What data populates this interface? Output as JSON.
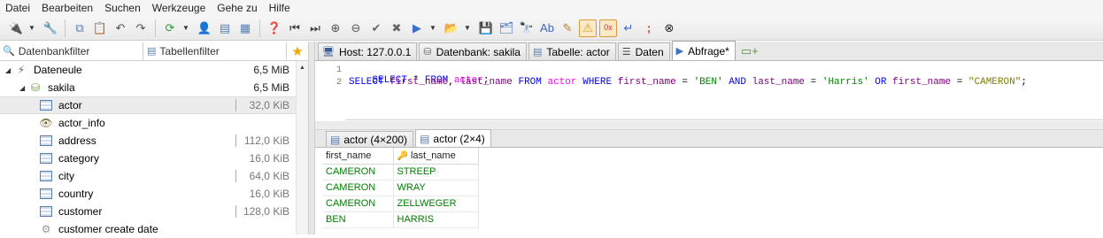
{
  "menu": [
    "Datei",
    "Bearbeiten",
    "Suchen",
    "Werkzeuge",
    "Gehe zu",
    "Hilfe"
  ],
  "toolbar": {
    "icons": [
      "session-manager-icon",
      "wrench-icon",
      "copy-icon",
      "paste-icon",
      "undo-icon",
      "redo-icon",
      "refresh-icon",
      "add-user-icon",
      "import-icon",
      "export-icon",
      "help-icon",
      "first-icon",
      "prev-icon",
      "add-row-icon",
      "delete-row-icon",
      "apply-icon",
      "cancel-icon",
      "run-icon",
      "explain-icon",
      "save-icon",
      "save-all-icon",
      "binoculars-icon",
      "format-icon",
      "edit-icon",
      "warning-icon",
      "zero-x-icon",
      "wrap-icon",
      "semicolon-icon",
      "stop-icon"
    ]
  },
  "filters": {
    "db_filter": "Datenbankfilter",
    "table_filter": "Tabellenfilter"
  },
  "tree": {
    "items": [
      {
        "label": "Dateneule",
        "size": "6,5 MiB",
        "level": 0
      },
      {
        "label": "sakila",
        "size": "6,5 MiB",
        "level": 1
      },
      {
        "label": "actor",
        "size": "32,0 KiB",
        "level": 2
      },
      {
        "label": "actor_info",
        "size": "",
        "level": 2
      },
      {
        "label": "address",
        "size": "112,0 KiB",
        "level": 2
      },
      {
        "label": "category",
        "size": "16,0 KiB",
        "level": 2
      },
      {
        "label": "city",
        "size": "64,0 KiB",
        "level": 2
      },
      {
        "label": "country",
        "size": "16,0 KiB",
        "level": 2
      },
      {
        "label": "customer",
        "size": "128,0 KiB",
        "level": 2
      },
      {
        "label": "customer create date",
        "size": "",
        "level": 2
      }
    ]
  },
  "tabs": [
    {
      "label": "Host: 127.0.0.1",
      "icon": "host-icon"
    },
    {
      "label": "Datenbank: sakila",
      "icon": "database-icon"
    },
    {
      "label": "Tabelle: actor",
      "icon": "table-icon"
    },
    {
      "label": "Daten",
      "icon": "data-icon"
    },
    {
      "label": "Abfrage*",
      "icon": "query-icon"
    }
  ],
  "editor": {
    "line_numbers": [
      "1",
      "2"
    ],
    "line1": "SELECT * FROM actor;",
    "line2": "SELECT first_name, last_name FROM actor WHERE first_name = 'BEN' AND last_name = 'Harris' OR first_name = \"CAMERON\";"
  },
  "result_tabs": [
    {
      "label": "actor (4×200)"
    },
    {
      "label": "actor (2×4)"
    }
  ],
  "grid": {
    "columns": [
      "first_name",
      "last_name"
    ],
    "rows": [
      [
        "CAMERON",
        "STREEP"
      ],
      [
        "CAMERON",
        "WRAY"
      ],
      [
        "CAMERON",
        "ZELLWEGER"
      ],
      [
        "BEN",
        "HARRIS"
      ]
    ]
  },
  "colors": {
    "keyword": "#0000ff",
    "table": "#ff00ff",
    "field": "#800080",
    "string": "#008000",
    "cell_text": "#008000"
  }
}
